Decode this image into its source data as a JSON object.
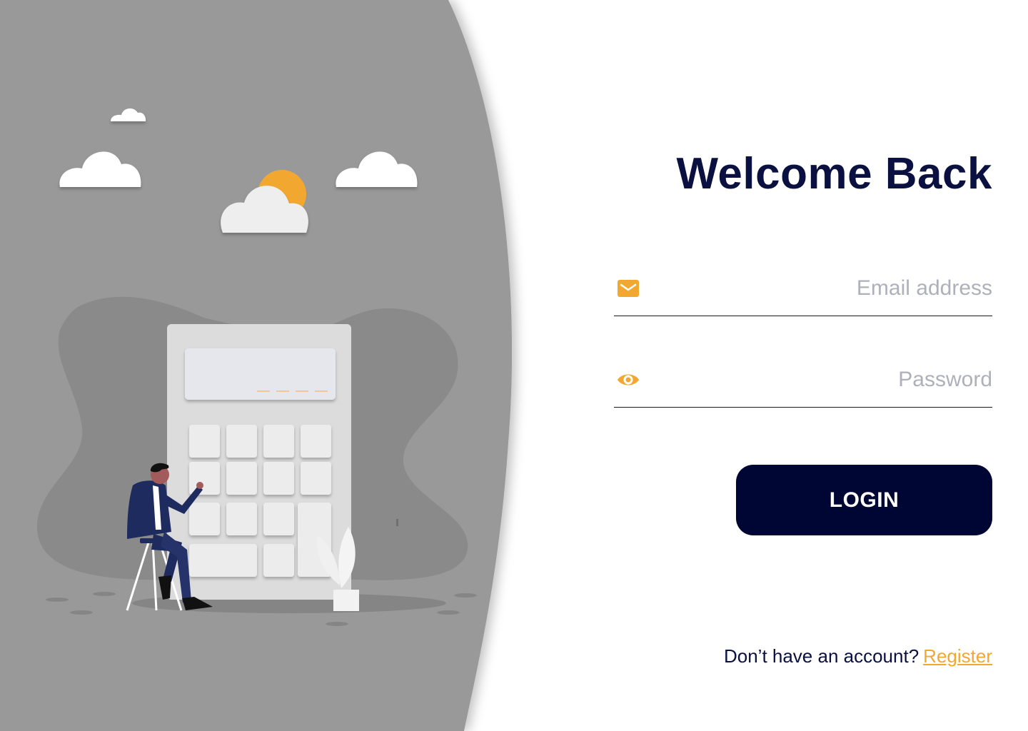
{
  "login": {
    "title": "Welcome Back",
    "email_placeholder": "Email address",
    "password_placeholder": "Password",
    "login_label": "LOGIN",
    "register_prompt": "Don’t have an account?",
    "register_link": "Register"
  },
  "icons": {
    "email": "mail-icon",
    "password": "eye-icon"
  },
  "colors": {
    "navy": "#000633",
    "accent": "#f2a830",
    "panel_gray": "#999999",
    "placeholder": "#aeb0bb"
  }
}
